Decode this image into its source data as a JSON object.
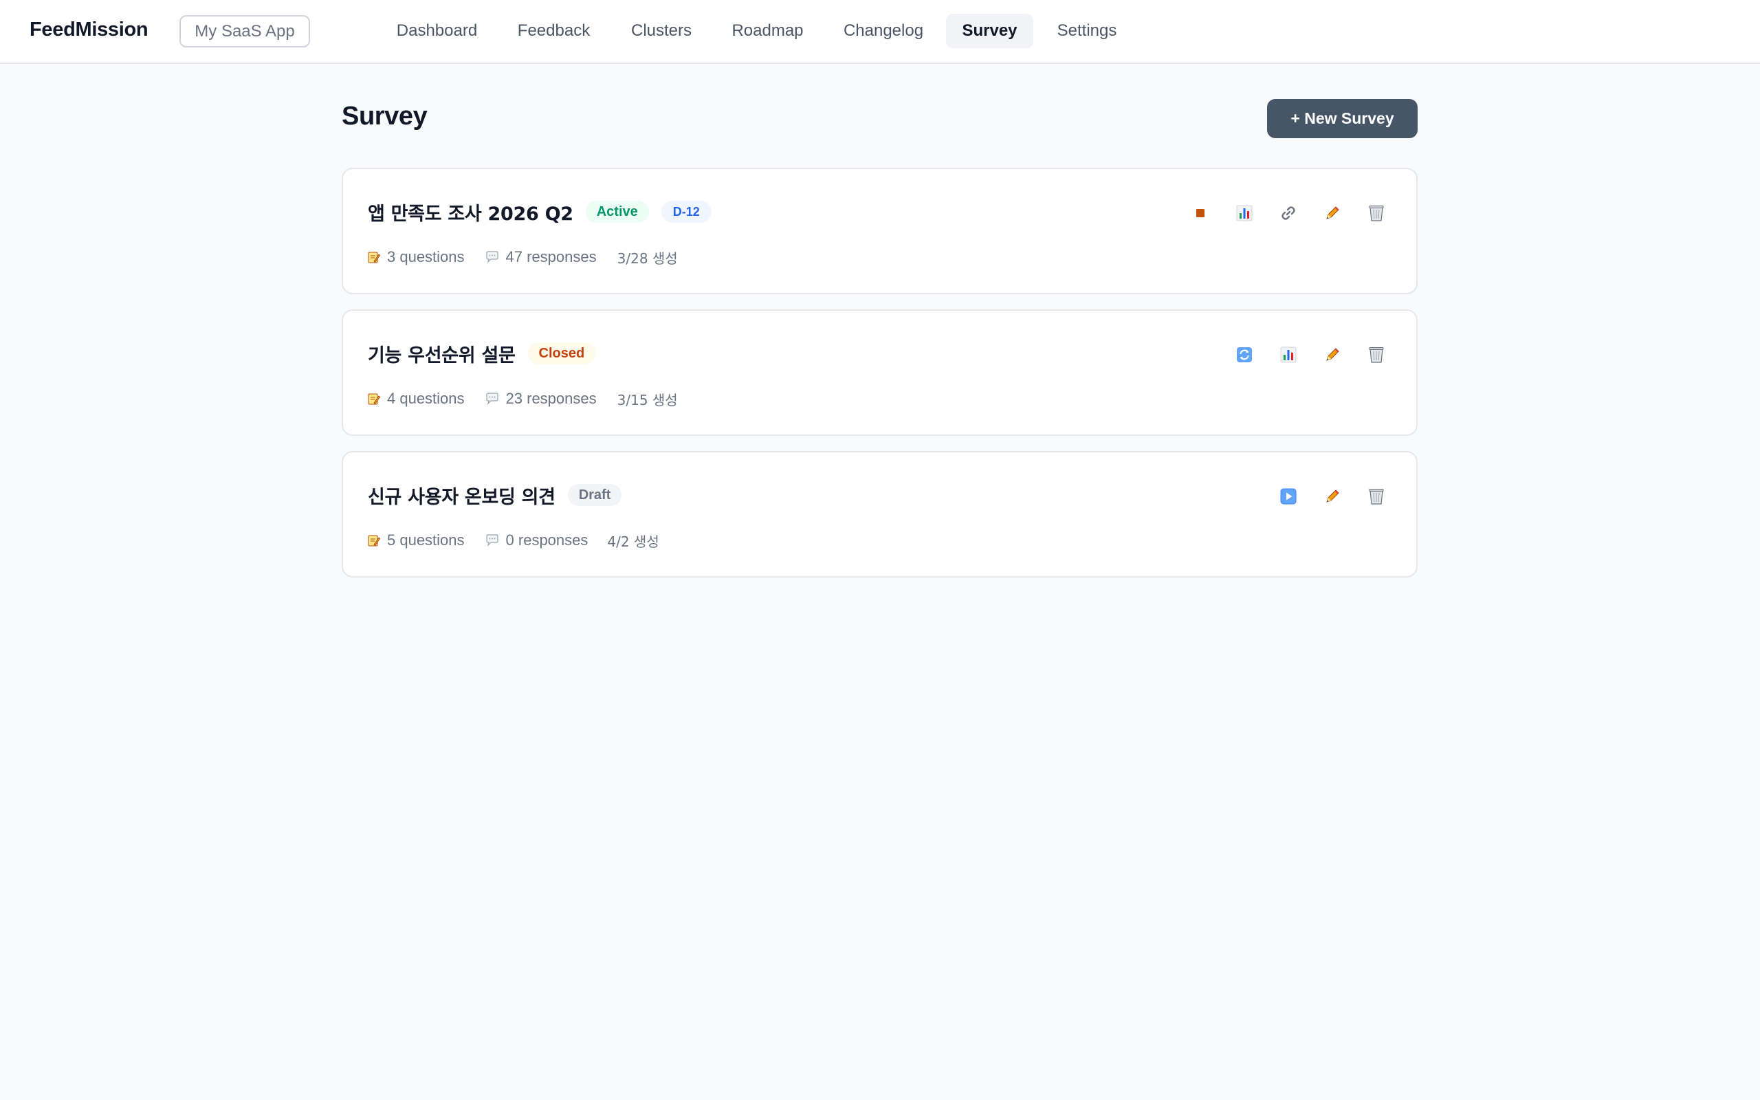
{
  "app": {
    "brand": "FeedMission",
    "project": "My SaaS App"
  },
  "nav": [
    {
      "label": "Dashboard",
      "active": false
    },
    {
      "label": "Feedback",
      "active": false
    },
    {
      "label": "Clusters",
      "active": false
    },
    {
      "label": "Roadmap",
      "active": false
    },
    {
      "label": "Changelog",
      "active": false
    },
    {
      "label": "Survey",
      "active": true
    },
    {
      "label": "Settings",
      "active": false
    }
  ],
  "page": {
    "title": "Survey",
    "new_button": "+ New Survey"
  },
  "surveys": [
    {
      "title": "앱 만족도 조사 2026 Q2",
      "status": "Active",
      "dday": "D-12",
      "questions": "3 questions",
      "responses": "47 responses",
      "created": "3/28 생성",
      "actions": [
        "stop-icon",
        "chart-icon",
        "link-icon",
        "pencil-icon",
        "trash-icon"
      ]
    },
    {
      "title": "기능 우선순위 설문",
      "status": "Closed",
      "questions": "4 questions",
      "responses": "23 responses",
      "created": "3/15 생성",
      "actions": [
        "reopen-icon",
        "chart-icon",
        "pencil-icon",
        "trash-icon"
      ]
    },
    {
      "title": "신규 사용자 온보딩 의견",
      "status": "Draft",
      "questions": "5 questions",
      "responses": "0 responses",
      "created": "4/2 생성",
      "actions": [
        "play-icon",
        "pencil-icon",
        "trash-icon"
      ]
    }
  ],
  "colors": {
    "primary_button": "#475569",
    "active_badge": "#059669",
    "closed_badge": "#c2410c",
    "draft_badge": "#6b7280",
    "dday_badge": "#2563eb"
  }
}
